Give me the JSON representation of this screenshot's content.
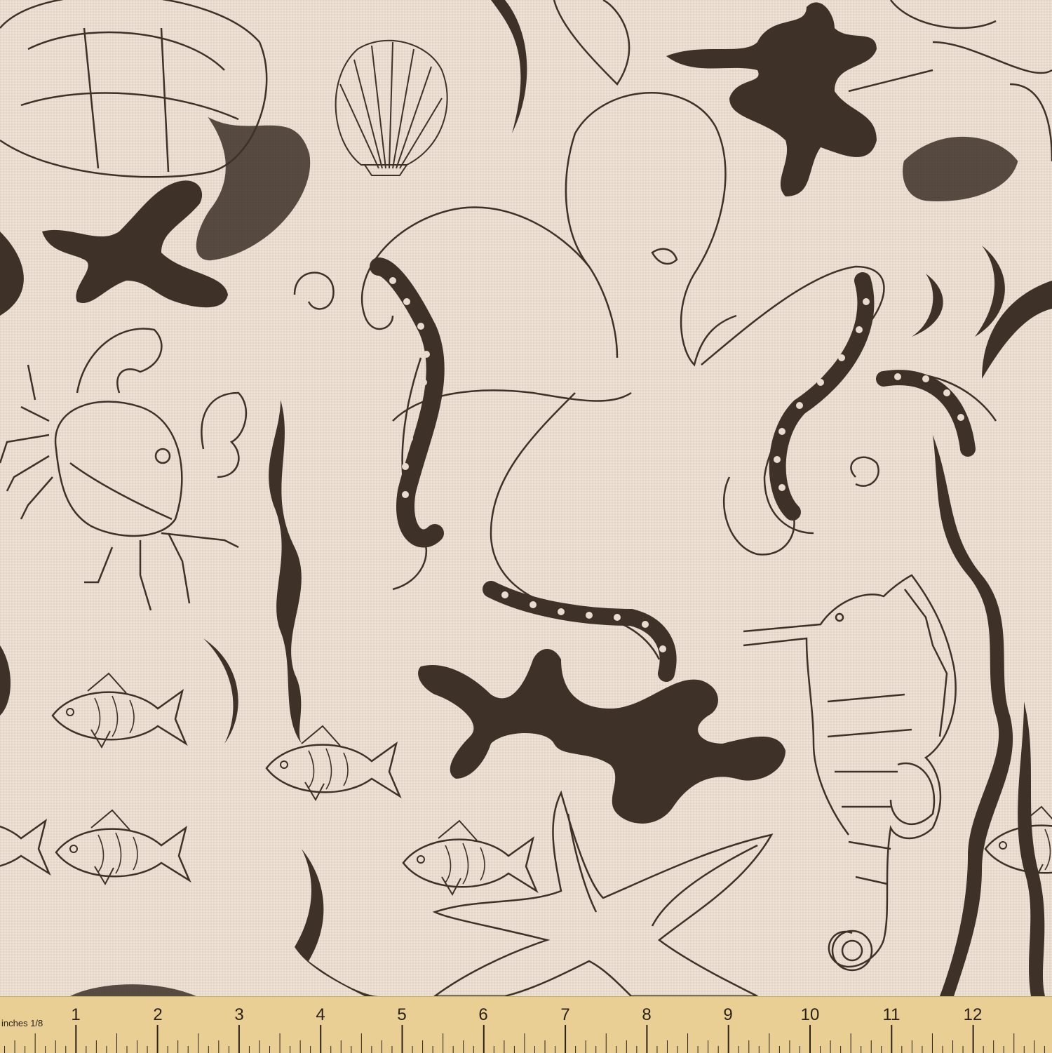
{
  "colors": {
    "fabric_background": "#e9dccf",
    "ink": "#3d3128",
    "ruler_background": "#e9cf94",
    "ruler_ink": "#2a2218"
  },
  "illustration": {
    "motifs": [
      "turtle",
      "scallop-shell",
      "octopus",
      "coral",
      "crab",
      "seaweed",
      "fish",
      "starfish",
      "seahorse"
    ]
  },
  "ruler": {
    "unit_label": "inches 1/8",
    "numbers": [
      "1",
      "2",
      "3",
      "4",
      "5",
      "6",
      "7",
      "8",
      "9",
      "10",
      "11",
      "12"
    ]
  }
}
